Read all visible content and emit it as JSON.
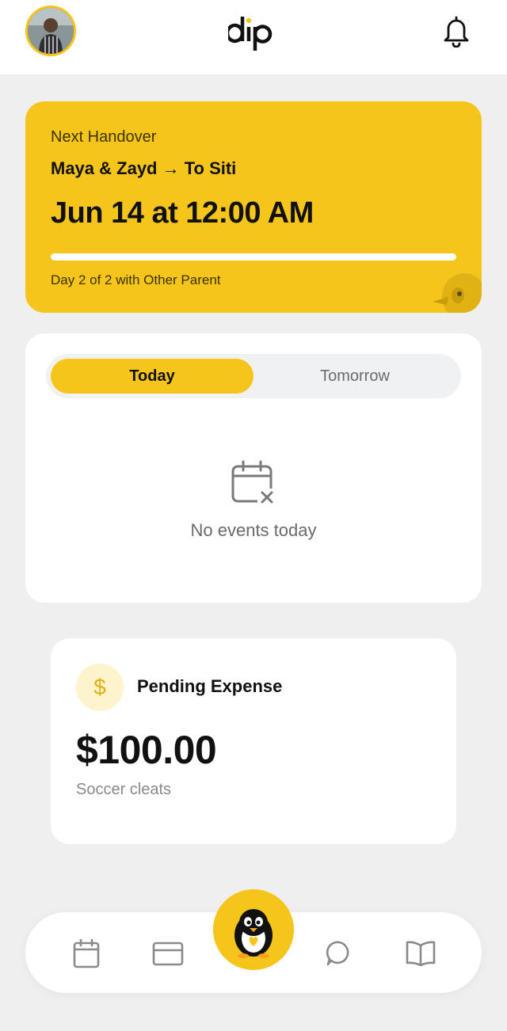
{
  "header": {
    "logo": "dip",
    "avatar_icon": "user-avatar",
    "notification_icon": "bell-icon"
  },
  "handover": {
    "label": "Next Handover",
    "who": "Maya & Zayd → To Siti",
    "when": "Jun 14 at 12:00 AM",
    "progress": 1.0,
    "day_text": "Day 2 of 2 with Other Parent"
  },
  "events": {
    "tabs": [
      "Today",
      "Tomorrow"
    ],
    "selected_tab": "Today",
    "empty_icon": "calendar-x-icon",
    "empty_text": "No events today"
  },
  "expense": {
    "icon": "$",
    "title": "Pending Expense",
    "amount": "$100.00",
    "description": "Soccer cleats"
  },
  "nav": {
    "items": [
      "calendar-icon",
      "card-icon",
      "penguin-icon",
      "chat-icon",
      "book-icon"
    ]
  },
  "colors": {
    "accent": "#f5c51c",
    "background": "#efefef"
  }
}
